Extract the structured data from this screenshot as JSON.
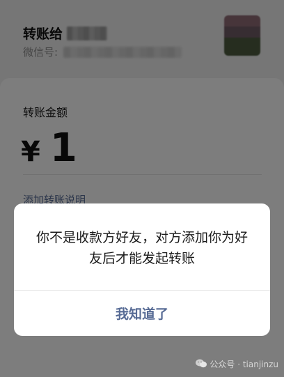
{
  "header": {
    "transfer_to_label": "转账给",
    "wechat_id_label": "微信号:"
  },
  "transfer": {
    "amount_label": "转账金额",
    "currency_symbol": "¥",
    "amount": "1",
    "add_note_link": "添加转账说明"
  },
  "dialog": {
    "message": "你不是收款方好友，对方添加你为好友后才能发起转账",
    "confirm_label": "我知道了"
  },
  "watermark": {
    "text": "公众号 · tianjinzu",
    "icon": "wechat-logo-icon"
  },
  "colors": {
    "link": "#576b95",
    "overlay": "rgba(0,0,0,0.5)"
  }
}
